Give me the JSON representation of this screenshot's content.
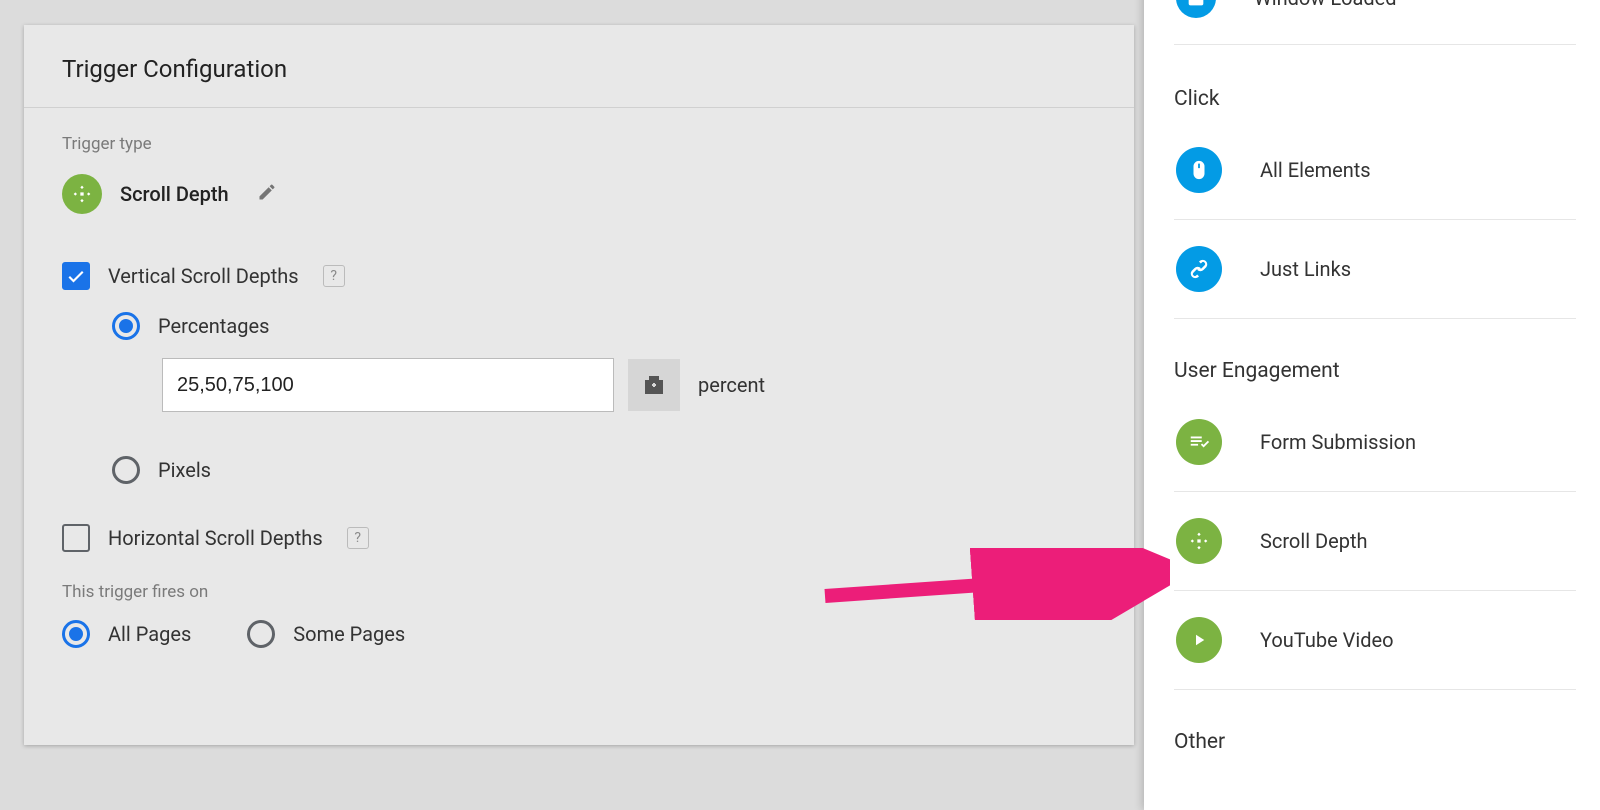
{
  "panel": {
    "title": "Trigger Configuration",
    "trigger_type_label": "Trigger type",
    "trigger_type_name": "Scroll Depth",
    "vertical_label": "Vertical Scroll Depths",
    "percentages_label": "Percentages",
    "percent_input_value": "25,50,75,100",
    "percent_unit": "percent",
    "pixels_label": "Pixels",
    "horizontal_label": "Horizontal Scroll Depths",
    "fires_on_label": "This trigger fires on",
    "all_pages_label": "All Pages",
    "some_pages_label": "Some Pages"
  },
  "sidebar": {
    "window_loaded": "Window Loaded",
    "section_click": "Click",
    "all_elements": "All Elements",
    "just_links": "Just Links",
    "section_user_engagement": "User Engagement",
    "form_submission": "Form Submission",
    "scroll_depth": "Scroll Depth",
    "youtube_video": "YouTube Video",
    "section_other": "Other"
  },
  "colors": {
    "green": "#7cb342",
    "blue": "#039be5",
    "accent_pink": "#ec1e79"
  }
}
